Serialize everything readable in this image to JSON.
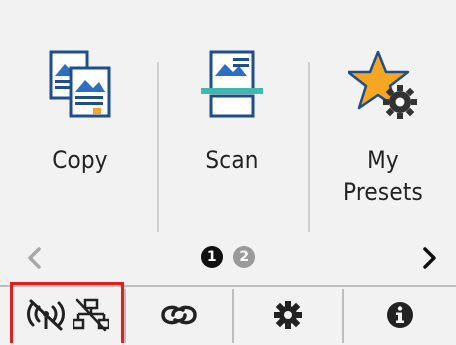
{
  "menu": {
    "tiles": [
      {
        "label_lines": [
          "Copy"
        ],
        "icon": "copy-icon"
      },
      {
        "label_lines": [
          "Scan"
        ],
        "icon": "scan-icon"
      },
      {
        "label_lines": [
          "My",
          "Presets"
        ],
        "icon": "my-presets-icon"
      }
    ]
  },
  "pager": {
    "prev_icon": "chevron-left-icon",
    "next_icon": "chevron-right-icon",
    "pages": [
      "1",
      "2"
    ],
    "current_page": "1"
  },
  "status_bar": {
    "items": [
      {
        "name": "network-status",
        "icons": [
          "wireless-off-icon",
          "wired-lan-off-icon"
        ]
      },
      {
        "name": "connect",
        "icons": [
          "link-icon"
        ]
      },
      {
        "name": "settings",
        "icons": [
          "gear-icon"
        ]
      },
      {
        "name": "information",
        "icons": [
          "info-icon"
        ]
      }
    ]
  },
  "colors": {
    "highlight": "#e01f1f",
    "accent_blue": "#2a6fc1",
    "accent_orange": "#f5a623",
    "scan_teal": "#3fb8af"
  }
}
